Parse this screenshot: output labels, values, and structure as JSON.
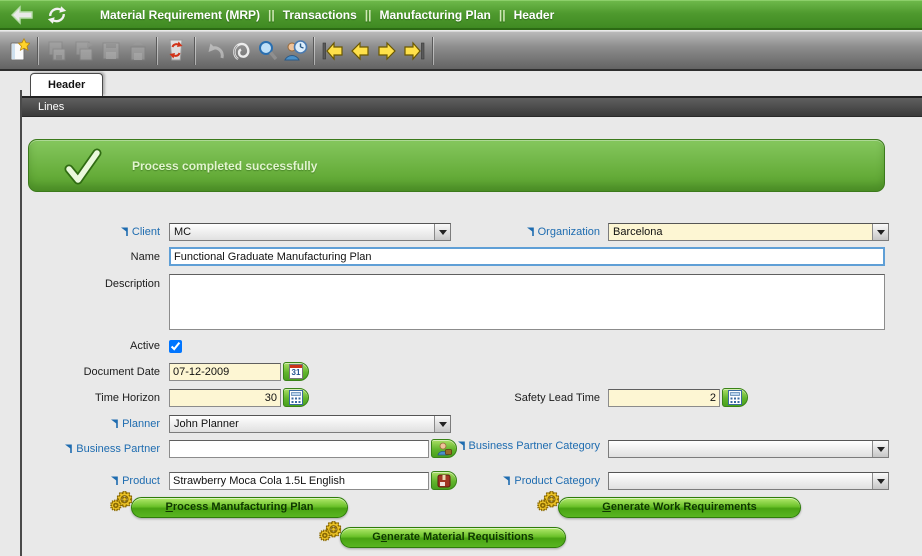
{
  "titlebar": {
    "separator": "||",
    "parts": [
      "Material Requirement (MRP)",
      "Transactions",
      "Manufacturing Plan",
      "Header"
    ]
  },
  "toolbar": {
    "icons": [
      {
        "name": "new-record",
        "enabled": true
      },
      {
        "name": "save-and-new",
        "enabled": false
      },
      {
        "name": "save-and-next",
        "enabled": false
      },
      {
        "name": "save",
        "enabled": false
      },
      {
        "name": "save-and-close",
        "enabled": false
      },
      {
        "name": "delete",
        "enabled": true
      },
      {
        "name": "undo",
        "enabled": false
      },
      {
        "name": "attachment",
        "enabled": true
      },
      {
        "name": "search",
        "enabled": true
      },
      {
        "name": "audit-trail",
        "enabled": true
      },
      {
        "name": "first-record",
        "enabled": true
      },
      {
        "name": "previous-record",
        "enabled": true
      },
      {
        "name": "next-record",
        "enabled": true
      },
      {
        "name": "last-record",
        "enabled": true
      }
    ]
  },
  "tabs": {
    "active_tab": "Header",
    "lines_bar": "Lines"
  },
  "message": {
    "type": "success",
    "text": "Process completed successfully"
  },
  "form": {
    "client": {
      "label": "Client",
      "value": "MC"
    },
    "organization": {
      "label": "Organization",
      "value": "Barcelona"
    },
    "name": {
      "label": "Name",
      "value": "Functional Graduate Manufacturing Plan"
    },
    "description": {
      "label": "Description",
      "value": ""
    },
    "active": {
      "label": "Active",
      "checked": "checked"
    },
    "document_date": {
      "label": "Document Date",
      "value": "07-12-2009"
    },
    "time_horizon": {
      "label": "Time Horizon",
      "value": "30"
    },
    "safety_lead_time": {
      "label": "Safety Lead Time",
      "value": "2"
    },
    "planner": {
      "label": "Planner",
      "value": "John Planner"
    },
    "business_partner": {
      "label": "Business Partner",
      "value": ""
    },
    "business_partner_category": {
      "label": "Business Partner Category",
      "value": ""
    },
    "product": {
      "label": "Product",
      "value": "Strawberry Moca Cola 1.5L English"
    },
    "product_category": {
      "label": "Product Category",
      "value": ""
    }
  },
  "icons": {
    "calendar_day": "31"
  },
  "process_buttons": {
    "process_manufacturing_plan": {
      "pre": "",
      "key": "P",
      "post": "rocess Manufacturing Plan"
    },
    "generate_work_requirements": {
      "pre": "",
      "key": "G",
      "post": "enerate Work Requirements"
    },
    "generate_material_requisitions": {
      "pre": "G",
      "key": "e",
      "post": "nerate Material Requisitions"
    }
  },
  "colors": {
    "header_green": "#4f9a2e",
    "success_green": "#68b345",
    "button_green": "#5cb421",
    "link_blue": "#1e6cb0",
    "field_yellow": "#fdf6d3"
  }
}
